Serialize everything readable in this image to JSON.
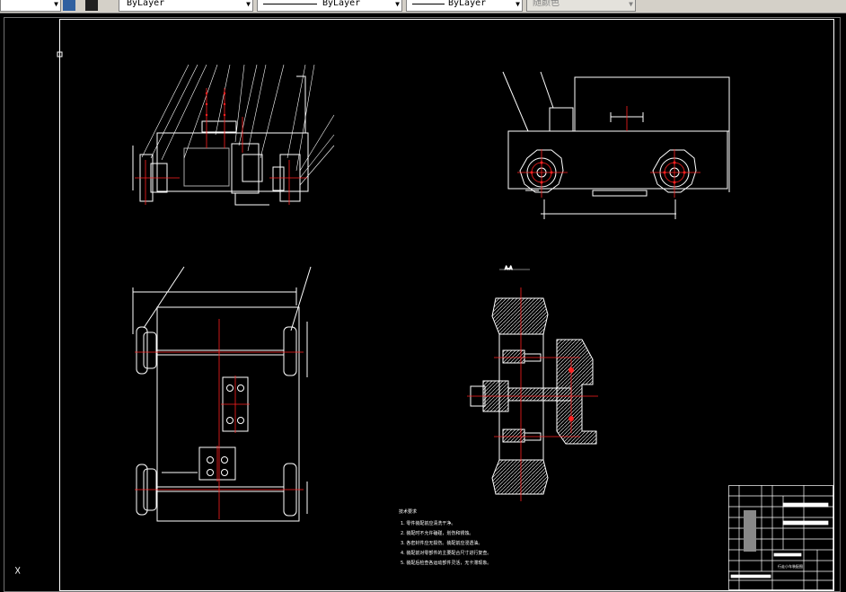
{
  "toolbar": {
    "layer_dropdown": {
      "value": "ByLayer"
    },
    "linetype_dropdown": {
      "value": "ByLayer"
    },
    "lineweight_dropdown": {
      "value": "ByLayer"
    },
    "plotstyle_dropdown": {
      "value": "随颜色"
    }
  },
  "notes": {
    "title": "技术要求",
    "items": [
      "1. 零件装配前应清洗干净。",
      "2. 装配时不允许磕碰，划伤和锈蚀。",
      "3. 各密封件应无损伤。装配前应浸透油。",
      "4. 装配前对零部件的主要配合尺寸进行复查。",
      "5. 装配后检查各运动部件灵活，无卡滞现象。"
    ]
  },
  "section_view": {
    "label": "A-A"
  },
  "title_block": {
    "drawing_name": "行走小车装配图"
  },
  "colors": {
    "line": "#ffffff",
    "center": "#ff2020",
    "accent": "#ff2020"
  },
  "ucs_icon": "ucs-icon"
}
